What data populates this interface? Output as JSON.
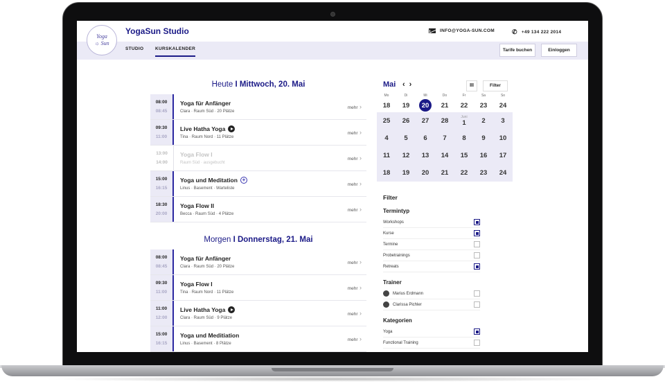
{
  "brand": {
    "logo_line1": "Yoga",
    "logo_line2": "Sun",
    "name": "YogaSun Studio"
  },
  "contact": {
    "email": "INFO@YOGA-SUN.COM",
    "phone": "+49 134 222 2014"
  },
  "nav": {
    "studio": "STUDIO",
    "kurskalender": "KURSKALENDER"
  },
  "buttons": {
    "tarife": "Tarife buchen",
    "login": "Einloggen"
  },
  "day1": {
    "prefix": "Heute",
    "label": "I Mittwoch, 20. Mai",
    "items": [
      {
        "start": "08:00",
        "end": "08:45",
        "name": "Yoga für Anfänger",
        "meta": "Clara · Raum Süd · 20 Plätze",
        "more": "mehr"
      },
      {
        "start": "09:30",
        "end": "11:00",
        "name": "Live Hatha Yoga",
        "meta": "Tina · Raum Nord · 11 Plätze",
        "more": "mehr"
      },
      {
        "start": "13:00",
        "end": "14:00",
        "name": "Yoga Flow I",
        "meta": "Raum Süd · ausgebucht",
        "more": "mehr"
      },
      {
        "start": "15:00",
        "end": "16:15",
        "name": "Yoga und Meditation",
        "meta": "Linus · Basement · Warteliste",
        "more": "mehr"
      },
      {
        "start": "18:30",
        "end": "20:00",
        "name": "Yoga Flow II",
        "meta": "Becca · Raum Süd · 4 Plätze",
        "more": "mehr"
      }
    ]
  },
  "day2": {
    "prefix": "Morgen",
    "label": "I Donnerstag, 21. Mai",
    "items": [
      {
        "start": "08:00",
        "end": "08:45",
        "name": "Yoga für Anfänger",
        "meta": "Clara · Raum Süd · 20 Plätze",
        "more": "mehr"
      },
      {
        "start": "09:30",
        "end": "11:00",
        "name": "Yoga Flow I",
        "meta": "Tina · Raum Nord · 11 Plätze",
        "more": "mehr"
      },
      {
        "start": "11:00",
        "end": "12:00",
        "name": "Live Hatha Yoga",
        "meta": "Clara · Raum Süd · 9 Plätze",
        "more": "mehr"
      },
      {
        "start": "15:00",
        "end": "16:15",
        "name": "Yoga und Meditiation",
        "meta": "Linus · Basement · 8 Plätze",
        "more": "mehr"
      }
    ]
  },
  "calendar": {
    "month": "Mai",
    "prev": "‹",
    "next": "›",
    "view_icon": "III",
    "filter_label": "Filter",
    "weekdays": [
      "Mo",
      "Di",
      "Mi",
      "Do",
      "Fr",
      "Sa",
      "So"
    ],
    "week0": [
      "18",
      "19",
      "20",
      "21",
      "22",
      "23",
      "24"
    ],
    "weeks": [
      [
        "25",
        "26",
        "27",
        "28",
        "1",
        "2",
        "3"
      ],
      [
        "4",
        "5",
        "6",
        "7",
        "8",
        "9",
        "10"
      ],
      [
        "11",
        "12",
        "13",
        "14",
        "15",
        "16",
        "17"
      ],
      [
        "18",
        "19",
        "20",
        "21",
        "22",
        "23",
        "24"
      ]
    ],
    "next_month_label": "Juni"
  },
  "filters": {
    "title": "Filter",
    "termintyp_title": "Termintyp",
    "termintyp": [
      {
        "label": "Workshops",
        "checked": true
      },
      {
        "label": "Kurse",
        "checked": true
      },
      {
        "label": "Termine",
        "checked": false
      },
      {
        "label": "Probetrainings",
        "checked": false
      },
      {
        "label": "Retreats",
        "checked": true
      }
    ],
    "trainer_title": "Trainer",
    "trainer": [
      {
        "label": "Marius Erdmann",
        "checked": false
      },
      {
        "label": "Clarissa Pichler",
        "checked": false
      }
    ],
    "kategorien_title": "Kategorien",
    "kategorien": [
      {
        "label": "Yoga",
        "checked": true
      },
      {
        "label": "Functional Training",
        "checked": false
      }
    ]
  }
}
